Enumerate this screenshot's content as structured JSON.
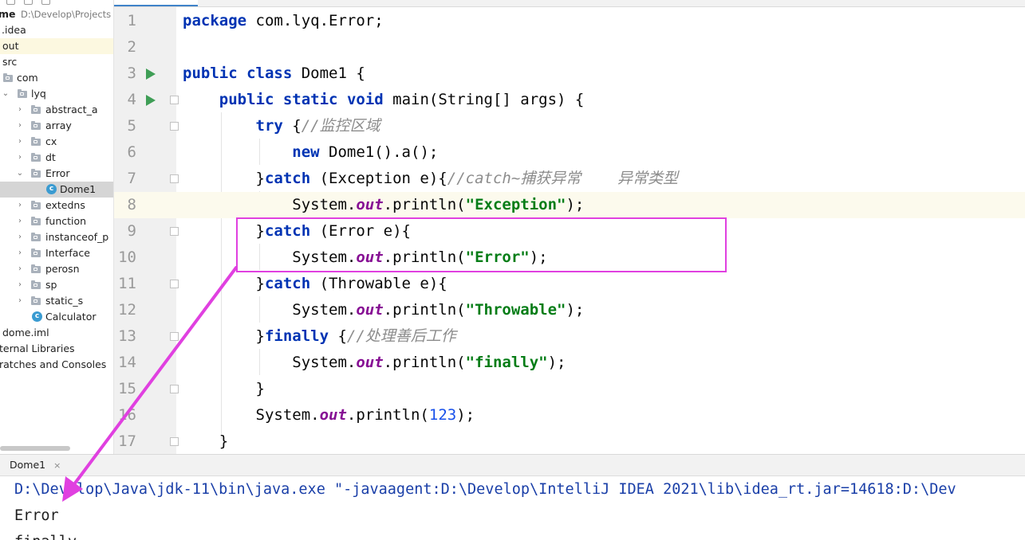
{
  "project_tree": {
    "root_name": "me",
    "root_path": "D:\\Develop\\Projects",
    "items": [
      {
        "label": ".idea"
      },
      {
        "label": "out"
      },
      {
        "label": "src"
      },
      {
        "label": "com"
      },
      {
        "label": "lyq"
      },
      {
        "label": "abstract_a"
      },
      {
        "label": "array"
      },
      {
        "label": "cx"
      },
      {
        "label": "dt"
      },
      {
        "label": "Error"
      },
      {
        "label": "Dome1"
      },
      {
        "label": "extedns"
      },
      {
        "label": "function"
      },
      {
        "label": "instanceof_p"
      },
      {
        "label": "Interface"
      },
      {
        "label": "perosn"
      },
      {
        "label": "sp"
      },
      {
        "label": "static_s"
      },
      {
        "label": "Calculator"
      },
      {
        "label": "dome.iml"
      },
      {
        "label": "ternal Libraries"
      },
      {
        "label": "ratches and Consoles"
      }
    ]
  },
  "editor": {
    "lines": [
      {
        "n": "1",
        "tokens": [
          {
            "t": "package",
            "c": "kw"
          },
          {
            "t": " com.lyq.Error;"
          }
        ]
      },
      {
        "n": "2",
        "tokens": []
      },
      {
        "n": "3",
        "tokens": [
          {
            "t": "public",
            "c": "kw"
          },
          {
            "t": " "
          },
          {
            "t": "class",
            "c": "kw"
          },
          {
            "t": " Dome1 {"
          }
        ]
      },
      {
        "n": "4",
        "tokens": [
          {
            "t": "    "
          },
          {
            "t": "public",
            "c": "kw"
          },
          {
            "t": " "
          },
          {
            "t": "static",
            "c": "kw"
          },
          {
            "t": " "
          },
          {
            "t": "void",
            "c": "kw"
          },
          {
            "t": " main(String[] args) {"
          }
        ]
      },
      {
        "n": "5",
        "tokens": [
          {
            "t": "        "
          },
          {
            "t": "try",
            "c": "kw"
          },
          {
            "t": " {"
          },
          {
            "t": "//监控区域",
            "c": "cmt"
          }
        ]
      },
      {
        "n": "6",
        "tokens": [
          {
            "t": "            "
          },
          {
            "t": "new",
            "c": "kw"
          },
          {
            "t": " Dome1().a();"
          }
        ]
      },
      {
        "n": "7",
        "tokens": [
          {
            "t": "        }"
          },
          {
            "t": "catch",
            "c": "kw"
          },
          {
            "t": " (Exception e){"
          },
          {
            "t": "//catch~捕获异常    异常类型",
            "c": "cmt"
          }
        ]
      },
      {
        "n": "8",
        "tokens": [
          {
            "t": "            System."
          },
          {
            "t": "out",
            "c": "field"
          },
          {
            "t": ".println("
          },
          {
            "t": "\"Exception\"",
            "c": "str"
          },
          {
            "t": ");"
          }
        ]
      },
      {
        "n": "9",
        "tokens": [
          {
            "t": "        }"
          },
          {
            "t": "catch",
            "c": "kw"
          },
          {
            "t": " (Error e){"
          }
        ]
      },
      {
        "n": "10",
        "tokens": [
          {
            "t": "            System."
          },
          {
            "t": "out",
            "c": "field"
          },
          {
            "t": ".println("
          },
          {
            "t": "\"Error\"",
            "c": "str"
          },
          {
            "t": ");"
          }
        ]
      },
      {
        "n": "11",
        "tokens": [
          {
            "t": "        }"
          },
          {
            "t": "catch",
            "c": "kw"
          },
          {
            "t": " (Throwable e){"
          }
        ]
      },
      {
        "n": "12",
        "tokens": [
          {
            "t": "            System."
          },
          {
            "t": "out",
            "c": "field"
          },
          {
            "t": ".println("
          },
          {
            "t": "\"Throwable\"",
            "c": "str"
          },
          {
            "t": ");"
          }
        ]
      },
      {
        "n": "13",
        "tokens": [
          {
            "t": "        }"
          },
          {
            "t": "finally",
            "c": "kw"
          },
          {
            "t": " {"
          },
          {
            "t": "//处理善后工作",
            "c": "cmt"
          }
        ]
      },
      {
        "n": "14",
        "tokens": [
          {
            "t": "            System."
          },
          {
            "t": "out",
            "c": "field"
          },
          {
            "t": ".println("
          },
          {
            "t": "\"finally\"",
            "c": "str"
          },
          {
            "t": ");"
          }
        ]
      },
      {
        "n": "15",
        "tokens": [
          {
            "t": "        }"
          }
        ]
      },
      {
        "n": "16",
        "tokens": [
          {
            "t": "        System."
          },
          {
            "t": "out",
            "c": "field"
          },
          {
            "t": ".println("
          },
          {
            "t": "123",
            "c": "num"
          },
          {
            "t": ");"
          }
        ]
      },
      {
        "n": "17",
        "tokens": [
          {
            "t": "    }"
          }
        ]
      }
    ]
  },
  "run_panel": {
    "tab_label": "Dome1",
    "tab_close": "×",
    "console_lines": [
      "D:\\Develop\\Java\\jdk-11\\bin\\java.exe \"-javaagent:D:\\Develop\\IntelliJ IDEA 2021\\lib\\idea_rt.jar=14618:D:\\Dev",
      "Error",
      "finally"
    ]
  },
  "colors": {
    "annotation": "#e040e0",
    "keyword": "#0033b3",
    "string": "#067d17",
    "field": "#871094",
    "comment": "#8c8c8c",
    "number": "#1750eb",
    "run_icon": "#3f9e56"
  }
}
